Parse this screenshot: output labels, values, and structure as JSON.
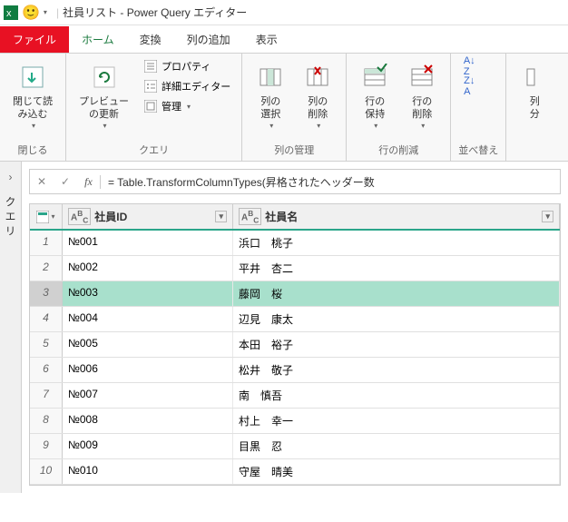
{
  "titlebar": {
    "query_name": "社員リスト",
    "app_name": "Power Query エディター"
  },
  "tabs": {
    "file": "ファイル",
    "home": "ホーム",
    "transform": "変換",
    "addcol": "列の追加",
    "view": "表示"
  },
  "ribbon": {
    "close": {
      "close_load": "閉じて読\nみ込む",
      "group": "閉じる"
    },
    "query": {
      "refresh": "プレビュー\nの更新",
      "properties": "プロパティ",
      "adv_editor": "詳細エディター",
      "manage": "管理",
      "group": "クエリ"
    },
    "columns": {
      "choose": "列の\n選択",
      "remove": "列の\n削除",
      "group": "列の管理"
    },
    "rows": {
      "keep": "行の\n保持",
      "remove": "行の\n削除",
      "group": "行の削減"
    },
    "sort": {
      "group": "並べ替え"
    },
    "split": {
      "split": "列\n分"
    }
  },
  "side": {
    "queries": "クエリ"
  },
  "formula": "= Table.TransformColumnTypes(昇格されたヘッダー数",
  "grid": {
    "columns": {
      "c1": "社員ID",
      "c2": "社員名"
    },
    "selected_row": 3,
    "rows": [
      {
        "id": "№001",
        "name": "浜口　桃子"
      },
      {
        "id": "№002",
        "name": "平井　杏二"
      },
      {
        "id": "№003",
        "name": "藤岡　桜"
      },
      {
        "id": "№004",
        "name": "辺見　康太"
      },
      {
        "id": "№005",
        "name": "本田　裕子"
      },
      {
        "id": "№006",
        "name": "松井　敬子"
      },
      {
        "id": "№007",
        "name": "南　慎吾"
      },
      {
        "id": "№008",
        "name": "村上　幸一"
      },
      {
        "id": "№009",
        "name": "目黒　忍"
      },
      {
        "id": "№010",
        "name": "守屋　晴美"
      }
    ]
  }
}
